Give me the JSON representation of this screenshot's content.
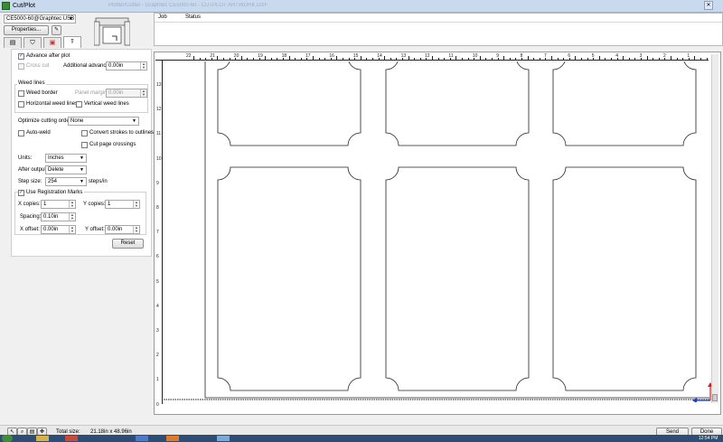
{
  "window": {
    "title": "Cut/Plot",
    "faded_title": "Plotter/Cutter - Graphtec CE5000-60 - CUTPLOT ARTWORK.DXF"
  },
  "device": {
    "selected": "CE5000-60@Graphtec USB"
  },
  "buttons": {
    "properties": "Properties...",
    "reset": "Reset",
    "send": "Send",
    "done": "Done"
  },
  "jobs": {
    "col_job": "Job",
    "col_status": "Status"
  },
  "tabs": [
    {
      "name": "printer-tab",
      "icon": "printer-icon"
    },
    {
      "name": "basket-tab",
      "icon": "basket-icon"
    },
    {
      "name": "frame-tab",
      "icon": "frame-icon"
    },
    {
      "name": "knife-tab",
      "icon": "knife-icon"
    }
  ],
  "options": {
    "advance_after_plot": {
      "label": "Advance after plot",
      "checked": true
    },
    "cross_cut": {
      "label": "Cross cut",
      "checked": false
    },
    "additional_advance": {
      "label": "Additional advance:",
      "value": "0.00in"
    },
    "weed_lines_title": "Weed lines",
    "weed_border": {
      "label": "Weed border",
      "checked": false
    },
    "panel_margin": {
      "label": "Panel margin:",
      "value": "0.00in"
    },
    "horizontal_weed_lines": {
      "label": "Horizontal weed lines",
      "checked": false
    },
    "vertical_weed_lines": {
      "label": "Vertical weed lines",
      "checked": false
    },
    "optimize_cutting_order": {
      "label": "Optimize cutting order:",
      "value": "None"
    },
    "auto_weld": {
      "label": "Auto-weld",
      "checked": false
    },
    "convert_strokes": {
      "label": "Convert strokes to outlines",
      "checked": false
    },
    "cut_page_crossings": {
      "label": "Cut page crossings",
      "checked": false
    },
    "units": {
      "label": "Units:",
      "value": "Inches"
    },
    "after_output": {
      "label": "After output:",
      "value": "Delete"
    },
    "step_size": {
      "label": "Step size:",
      "value": "254",
      "unit": "steps/in"
    },
    "use_registration_marks": {
      "label": "Use Registration Marks",
      "checked": true
    },
    "x_copies": {
      "label": "X copies:",
      "value": "1"
    },
    "y_copies": {
      "label": "Y copies:",
      "value": "1"
    },
    "spacing": {
      "label": "Spacing:",
      "value": "0.10in"
    },
    "x_offset": {
      "label": "X offset:",
      "value": "0.00in"
    },
    "y_offset": {
      "label": "Y offset:",
      "value": "0.00in"
    }
  },
  "ruler": {
    "top": [
      "22",
      "21",
      "20",
      "19",
      "18",
      "17",
      "16",
      "15",
      "14",
      "13",
      "12",
      "11",
      "10",
      "9",
      "8",
      "7",
      "6",
      "5",
      "4",
      "3",
      "2",
      "1"
    ],
    "left": [
      "13",
      "12",
      "11",
      "10",
      "9",
      "8",
      "7",
      "6",
      "5",
      "4",
      "3",
      "2",
      "1",
      "0"
    ]
  },
  "status": {
    "total_size_label": "Total size:",
    "total_size_value": "21.18in x 48.96in"
  },
  "taskbar": {
    "time": "12:54 PM"
  }
}
